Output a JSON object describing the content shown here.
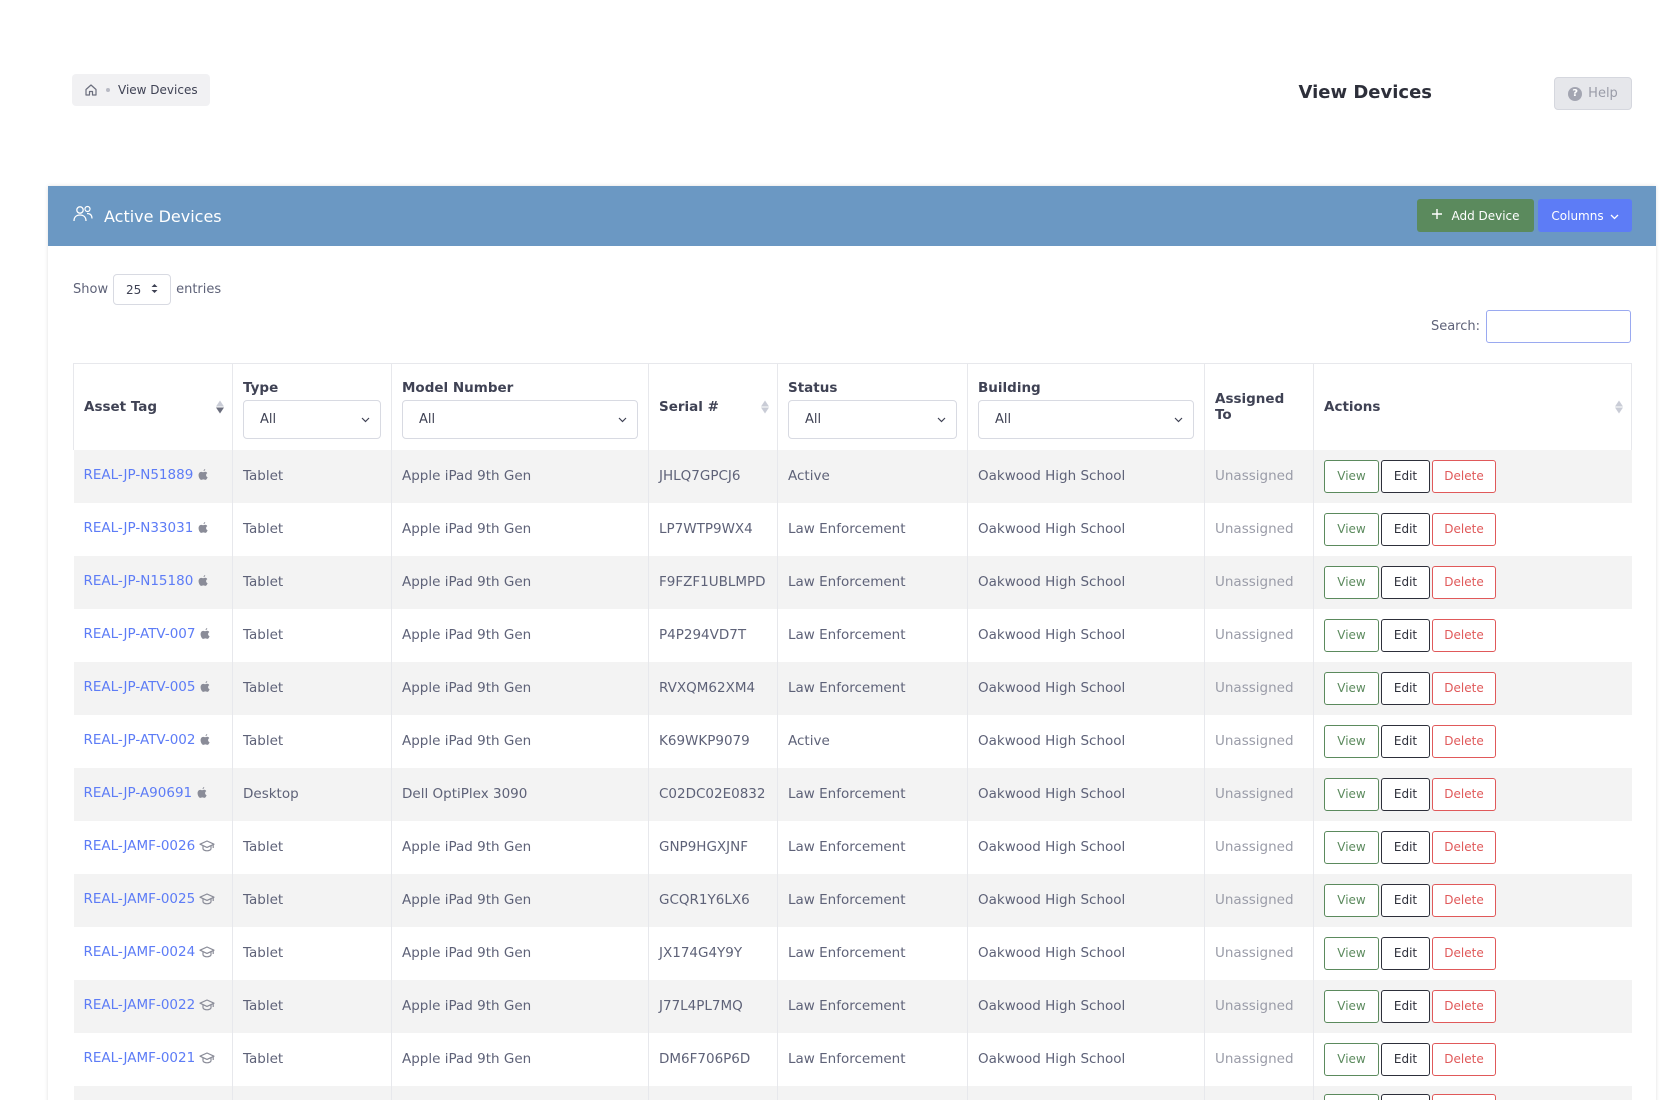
{
  "breadcrumb": {
    "current": "View Devices"
  },
  "header": {
    "title": "View Devices",
    "help_label": "Help"
  },
  "card": {
    "title": "Active Devices",
    "add_label": "Add Device",
    "columns_label": "Columns",
    "accent_color": "#6b98c3"
  },
  "length": {
    "show_label": "Show",
    "value": "25",
    "entries_label": "entries"
  },
  "search": {
    "label": "Search:",
    "value": ""
  },
  "columns": {
    "asset_tag": "Asset Tag",
    "type": "Type",
    "model": "Model Number",
    "serial": "Serial #",
    "status": "Status",
    "building": "Building",
    "assigned": "Assigned To",
    "actions": "Actions"
  },
  "filters": {
    "type": "All",
    "model": "All",
    "status": "All",
    "building": "All"
  },
  "actions": {
    "view": "View",
    "edit": "Edit",
    "delete": "Delete"
  },
  "rows": [
    {
      "asset_tag": "REAL-JP-N51889",
      "icon": "apple-icon",
      "type": "Tablet",
      "model": "Apple iPad 9th Gen",
      "serial": "JHLQ7GPCJ6",
      "status": "Active",
      "building": "Oakwood High School",
      "assigned": "Unassigned"
    },
    {
      "asset_tag": "REAL-JP-N33031",
      "icon": "apple-icon",
      "type": "Tablet",
      "model": "Apple iPad 9th Gen",
      "serial": "LP7WTP9WX4",
      "status": "Law Enforcement",
      "building": "Oakwood High School",
      "assigned": "Unassigned"
    },
    {
      "asset_tag": "REAL-JP-N15180",
      "icon": "apple-icon",
      "type": "Tablet",
      "model": "Apple iPad 9th Gen",
      "serial": "F9FZF1UBLMPD",
      "status": "Law Enforcement",
      "building": "Oakwood High School",
      "assigned": "Unassigned"
    },
    {
      "asset_tag": "REAL-JP-ATV-007",
      "icon": "apple-icon",
      "type": "Tablet",
      "model": "Apple iPad 9th Gen",
      "serial": "P4P294VD7T",
      "status": "Law Enforcement",
      "building": "Oakwood High School",
      "assigned": "Unassigned"
    },
    {
      "asset_tag": "REAL-JP-ATV-005",
      "icon": "apple-icon",
      "type": "Tablet",
      "model": "Apple iPad 9th Gen",
      "serial": "RVXQM62XM4",
      "status": "Law Enforcement",
      "building": "Oakwood High School",
      "assigned": "Unassigned"
    },
    {
      "asset_tag": "REAL-JP-ATV-002",
      "icon": "apple-icon",
      "type": "Tablet",
      "model": "Apple iPad 9th Gen",
      "serial": "K69WKP9079",
      "status": "Active",
      "building": "Oakwood High School",
      "assigned": "Unassigned"
    },
    {
      "asset_tag": "REAL-JP-A90691",
      "icon": "apple-icon",
      "type": "Desktop",
      "model": "Dell OptiPlex 3090",
      "serial": "C02DC02E0832",
      "status": "Law Enforcement",
      "building": "Oakwood High School",
      "assigned": "Unassigned"
    },
    {
      "asset_tag": "REAL-JAMF-0026",
      "icon": "graduation-cap-icon",
      "type": "Tablet",
      "model": "Apple iPad 9th Gen",
      "serial": "GNP9HGXJNF",
      "status": "Law Enforcement",
      "building": "Oakwood High School",
      "assigned": "Unassigned"
    },
    {
      "asset_tag": "REAL-JAMF-0025",
      "icon": "graduation-cap-icon",
      "type": "Tablet",
      "model": "Apple iPad 9th Gen",
      "serial": "GCQR1Y6LX6",
      "status": "Law Enforcement",
      "building": "Oakwood High School",
      "assigned": "Unassigned"
    },
    {
      "asset_tag": "REAL-JAMF-0024",
      "icon": "graduation-cap-icon",
      "type": "Tablet",
      "model": "Apple iPad 9th Gen",
      "serial": "JX174G4Y9Y",
      "status": "Law Enforcement",
      "building": "Oakwood High School",
      "assigned": "Unassigned"
    },
    {
      "asset_tag": "REAL-JAMF-0022",
      "icon": "graduation-cap-icon",
      "type": "Tablet",
      "model": "Apple iPad 9th Gen",
      "serial": "J77L4PL7MQ",
      "status": "Law Enforcement",
      "building": "Oakwood High School",
      "assigned": "Unassigned"
    },
    {
      "asset_tag": "REAL-JAMF-0021",
      "icon": "graduation-cap-icon",
      "type": "Tablet",
      "model": "Apple iPad 9th Gen",
      "serial": "DM6F706P6D",
      "status": "Law Enforcement",
      "building": "Oakwood High School",
      "assigned": "Unassigned"
    },
    {
      "asset_tag": "",
      "icon": "",
      "type": "",
      "model": "",
      "serial": "",
      "status": "",
      "building": "",
      "assigned": ""
    }
  ]
}
